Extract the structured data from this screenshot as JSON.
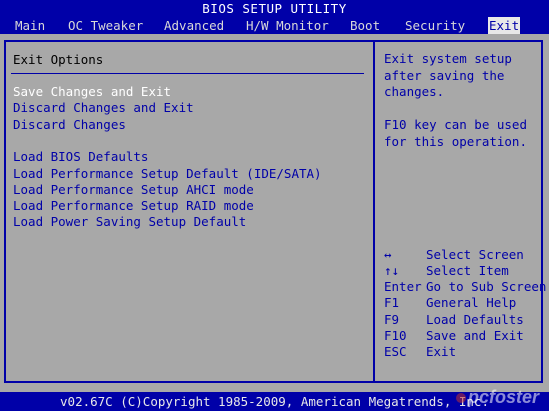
{
  "title": "BIOS SETUP UTILITY",
  "menu": [
    {
      "label": "Main"
    },
    {
      "label": "OC Tweaker"
    },
    {
      "label": "Advanced"
    },
    {
      "label": "H/W Monitor"
    },
    {
      "label": "Boot"
    },
    {
      "label": "Security"
    },
    {
      "label": "Exit"
    }
  ],
  "active_menu": "Exit",
  "section_title": "Exit Options",
  "options": [
    {
      "label": "Save Changes and Exit",
      "selected": true
    },
    {
      "label": "Discard Changes and Exit"
    },
    {
      "label": "Discard Changes"
    },
    {
      "label": "Load BIOS Defaults"
    },
    {
      "label": "Load Performance Setup Default (IDE/SATA)"
    },
    {
      "label": "Load Performance Setup AHCI mode"
    },
    {
      "label": "Load Performance Setup RAID mode"
    },
    {
      "label": "Load Power Saving Setup Default"
    }
  ],
  "help_text": "Exit system setup\nafter saving the\nchanges.\n\nF10 key can be used\nfor this operation.",
  "key_legend": [
    {
      "key": "↔",
      "desc": "Select Screen"
    },
    {
      "key": "↑↓",
      "desc": "Select Item"
    },
    {
      "key": "Enter",
      "desc": "Go to Sub Screen"
    },
    {
      "key": "F1",
      "desc": "General Help"
    },
    {
      "key": "F9",
      "desc": "Load Defaults"
    },
    {
      "key": "F10",
      "desc": "Save and Exit"
    },
    {
      "key": "ESC",
      "desc": "Exit"
    }
  ],
  "footer": "v02.67C (C)Copyright 1985-2009, American Megatrends, Inc.",
  "watermark": "pcfoster",
  "colors": {
    "primary": "#0000a8",
    "background": "#a8a8a8",
    "highlight": "#ffffff"
  }
}
